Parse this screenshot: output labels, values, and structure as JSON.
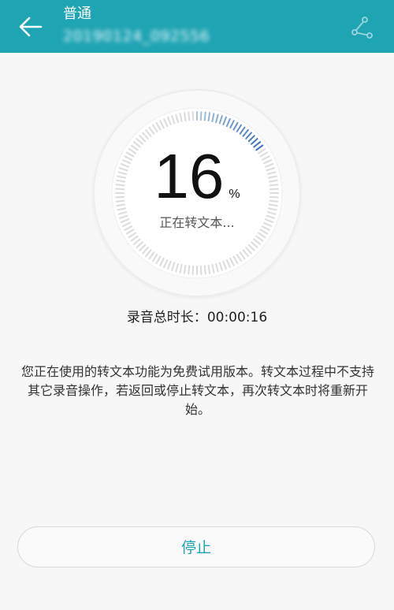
{
  "header": {
    "title": "普通",
    "subtitle": "20190124_092556",
    "back_icon": "arrow-left-icon",
    "share_icon": "share-icon"
  },
  "progress": {
    "value": 16,
    "unit": "%",
    "status": "正在转文本..."
  },
  "duration": {
    "label": "录音总时长：",
    "value": "00:00:16"
  },
  "notice": "您正在使用的转文本功能为免费试用版本。转文本过程中不支持其它录音操作，若返回或停止转文本，再次转文本时将重新开始。",
  "stop_button": {
    "label": "停止"
  },
  "colors": {
    "accent": "#1fa4b4",
    "progress_active": "#3b6fb6",
    "tick_inactive": "#dcdcdc"
  }
}
